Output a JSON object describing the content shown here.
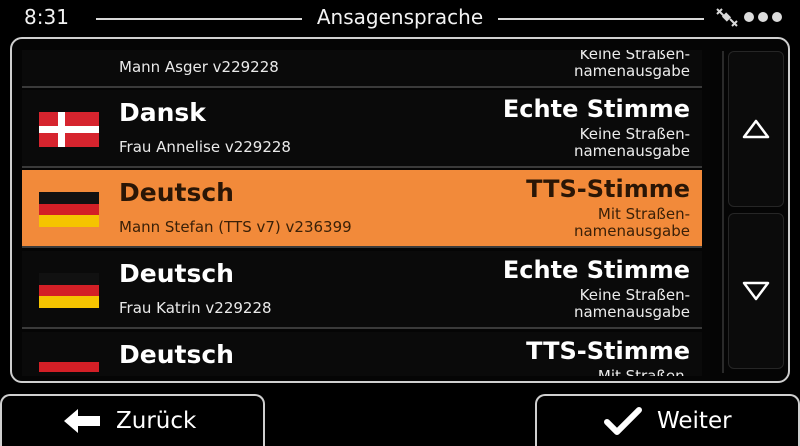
{
  "status": {
    "time": "8:31"
  },
  "header": {
    "title": "Ansagensprache"
  },
  "rows": [
    {
      "language": "",
      "voice": "Mann Asger v229228",
      "type": "",
      "street": "Keine Straßen-\nnamenausgabe",
      "flag": "danish"
    },
    {
      "language": "Dansk",
      "voice": "Frau Annelise v229228",
      "type": "Echte Stimme",
      "street": "Keine Straßen-\nnamenausgabe",
      "flag": "danish"
    },
    {
      "language": "Deutsch",
      "voice": "Mann Stefan (TTS v7) v236399",
      "type": "TTS-Stimme",
      "street": "Mit Straßen-\nnamenausgabe",
      "flag": "german",
      "selected": true
    },
    {
      "language": "Deutsch",
      "voice": "Frau Katrin v229228",
      "type": "Echte Stimme",
      "street": "Keine Straßen-\nnamenausgabe",
      "flag": "german"
    },
    {
      "language": "Deutsch",
      "voice": "",
      "type": "TTS-Stimme",
      "street": "Mit Straßen-",
      "flag": "german"
    }
  ],
  "footer": {
    "back_label": "Zurück",
    "next_label": "Weiter"
  },
  "icons": {
    "satellite": "satellite-icon",
    "up": "arrow-up-icon",
    "down": "arrow-down-icon",
    "back": "arrow-left-icon",
    "next": "checkmark-icon"
  },
  "colors": {
    "selected": "#f28a3a",
    "background": "#000000",
    "border": "#cfcfcf"
  }
}
